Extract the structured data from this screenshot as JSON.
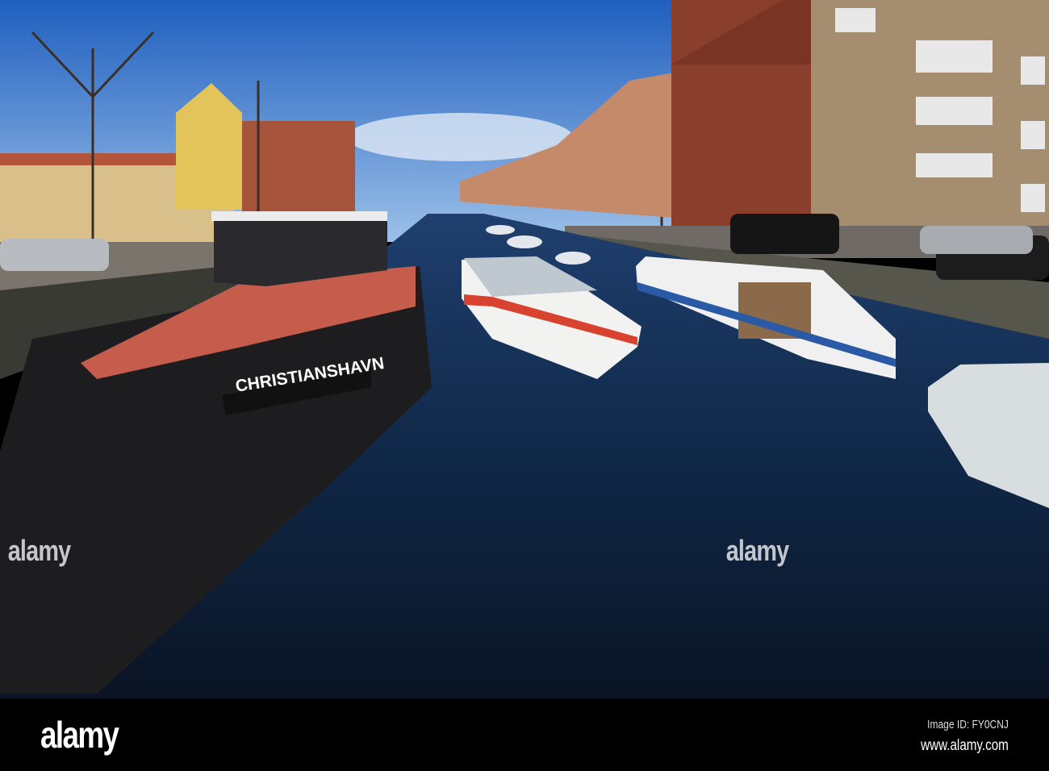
{
  "photo": {
    "boat_name": "CHRISTIANSHAVN",
    "watermark": "alamy"
  },
  "footer": {
    "logo": "alamy",
    "image_id": "Image ID: FY0CNJ",
    "url": "www.alamy.com"
  },
  "colors": {
    "sky": "#2f6fc4",
    "water": "#0d1d33",
    "brick": "#8a3f2c",
    "hull": "#1d1d1f"
  }
}
